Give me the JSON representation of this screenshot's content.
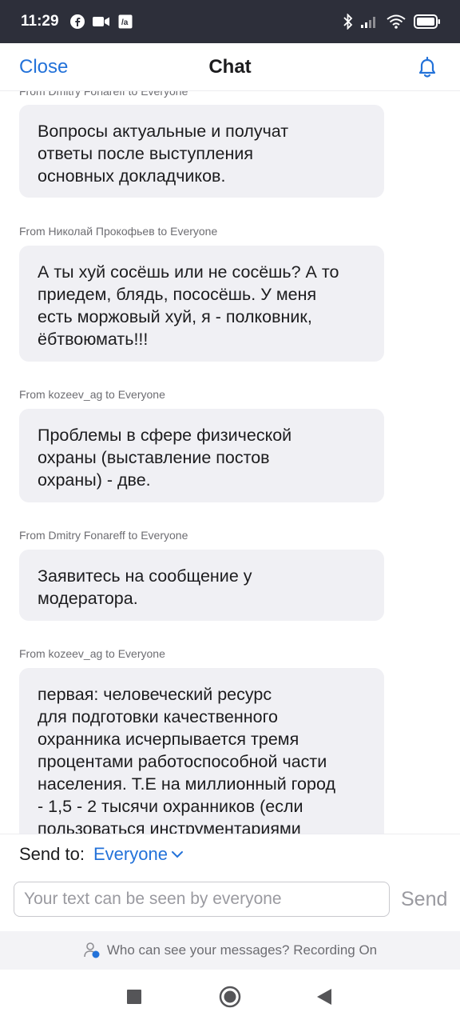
{
  "status_bar": {
    "time": "11:29",
    "left_icons": [
      "facebook-icon",
      "video-camera-icon",
      "app-notification-icon"
    ],
    "right_icons": [
      "bluetooth-icon",
      "cellular-signal-icon",
      "wifi-icon",
      "battery-icon"
    ]
  },
  "header": {
    "close_label": "Close",
    "title": "Chat",
    "bell_icon": "bell-icon"
  },
  "messages": [
    {
      "sender": "From Dmitry Fonareff to Everyone",
      "text": "Вопросы актуальные и получат\nответы после выступления\nосновных докладчиков."
    },
    {
      "sender": "From Николай Прокофьев to Everyone",
      "text": "А ты хуй сосёшь или не сосёшь? А то\nприедем, блядь, пососёшь. У меня\nесть моржовый хуй, я - полковник,\nёбтвоюмать!!!"
    },
    {
      "sender": "From kozeev_ag to Everyone",
      "text": "Проблемы в сфере физической\nохраны (выставление постов\nохраны) - две."
    },
    {
      "sender": "From Dmitry Fonareff to Everyone",
      "text": "Заявитесь на сообщение у\nмодератора."
    },
    {
      "sender": "From kozeev_ag to Everyone",
      "text": "первая: человеческий ресурс\nдля подготовки качественного\nохранника исчерпывается тремя\nпроцентами работоспособной части\nнаселения. Т.Е на миллионный город\n- 1,5 - 2 тысячи охранников (если\nпользоваться инструментариями"
    }
  ],
  "send_to": {
    "label": "Send to:",
    "value": "Everyone"
  },
  "input": {
    "placeholder": "Your text can be seen by everyone",
    "value": "",
    "send_label": "Send"
  },
  "recording_notice": "Who can see your messages? Recording On",
  "colors": {
    "accent": "#2372d9",
    "status_bar_bg": "#2d2f3a",
    "bubble_bg": "#f0f0f4",
    "sender_text": "#6d6d72"
  },
  "nav_bar": {
    "icons": [
      "recents-square-icon",
      "home-circle-icon",
      "back-triangle-icon"
    ]
  }
}
